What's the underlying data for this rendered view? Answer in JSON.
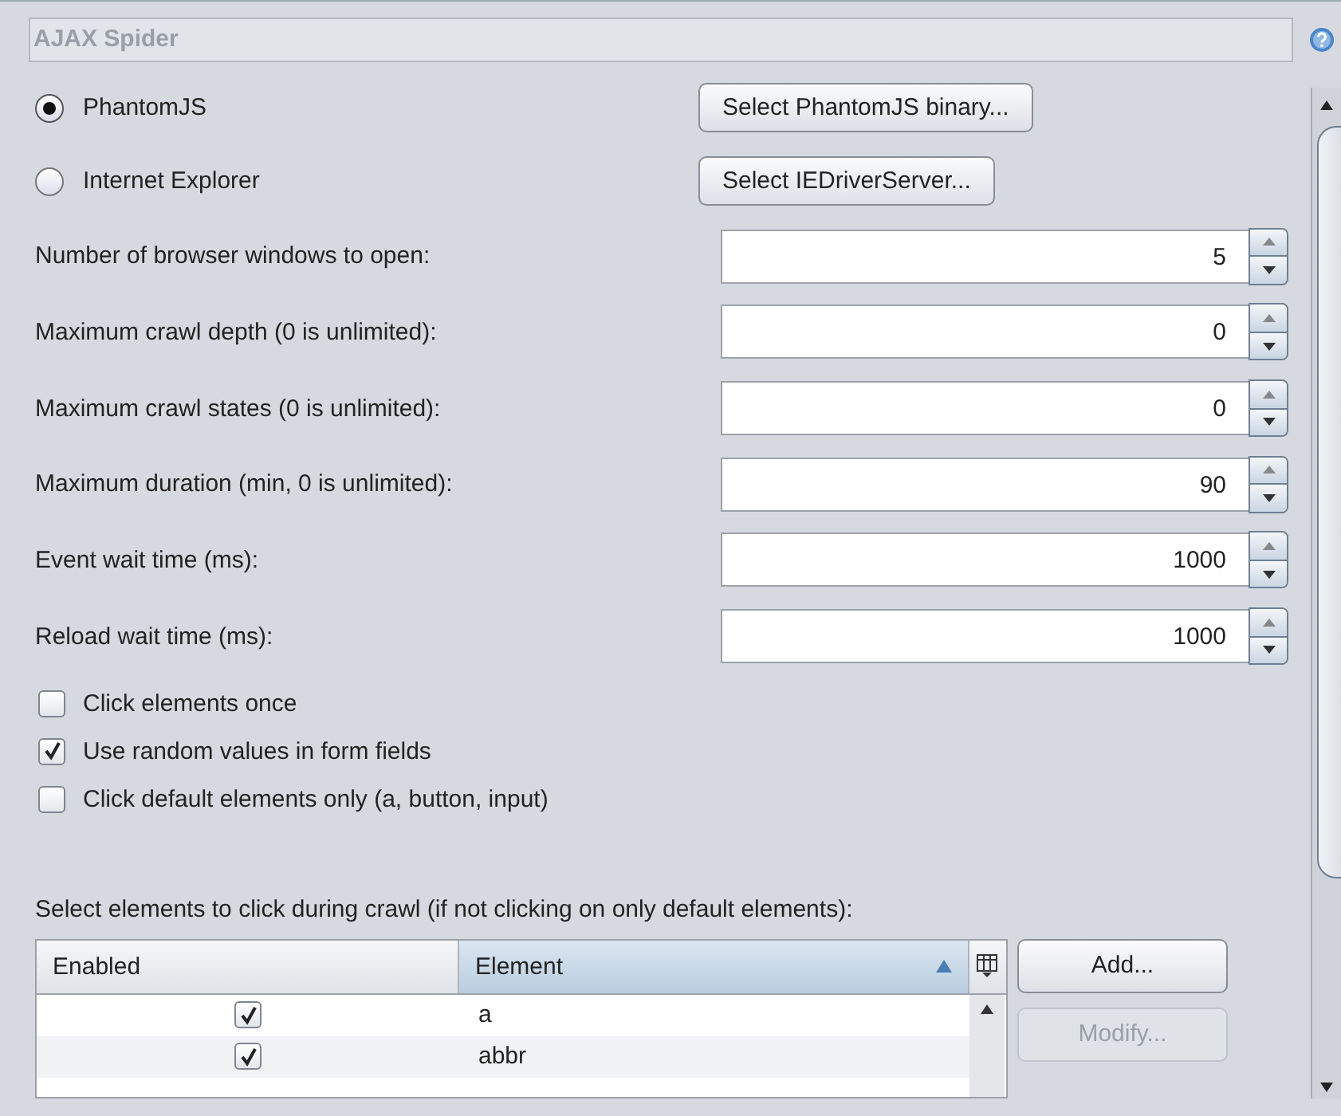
{
  "panel": {
    "title": "AJAX Spider"
  },
  "browsers": [
    {
      "label": "PhantomJS",
      "selected": true,
      "button": "Select PhantomJS binary..."
    },
    {
      "label": "Internet Explorer",
      "selected": false,
      "button": "Select IEDriverServer..."
    }
  ],
  "spinners": [
    {
      "label": "Number of browser windows to open:",
      "value": "5"
    },
    {
      "label": "Maximum crawl depth (0 is unlimited):",
      "value": "0"
    },
    {
      "label": "Maximum crawl states (0 is unlimited):",
      "value": "0"
    },
    {
      "label": "Maximum duration (min, 0 is unlimited):",
      "value": "90"
    },
    {
      "label": "Event wait time (ms):",
      "value": "1000"
    },
    {
      "label": "Reload wait time (ms):",
      "value": "1000"
    }
  ],
  "options": [
    {
      "label": "Click elements once",
      "checked": false
    },
    {
      "label": "Use random values in form fields",
      "checked": true
    },
    {
      "label": "Click default elements only (a, button, input)",
      "checked": false
    }
  ],
  "elements_label": "Select elements to click during crawl (if not clicking on only default elements):",
  "table": {
    "columns": [
      {
        "label": "Enabled",
        "sorted": false
      },
      {
        "label": "Element",
        "sorted": true
      }
    ],
    "rows": [
      {
        "enabled": true,
        "element": "a"
      },
      {
        "enabled": true,
        "element": "abbr"
      }
    ]
  },
  "buttons": [
    {
      "label": "Add...",
      "disabled": false
    },
    {
      "label": "Modify...",
      "disabled": true
    }
  ]
}
